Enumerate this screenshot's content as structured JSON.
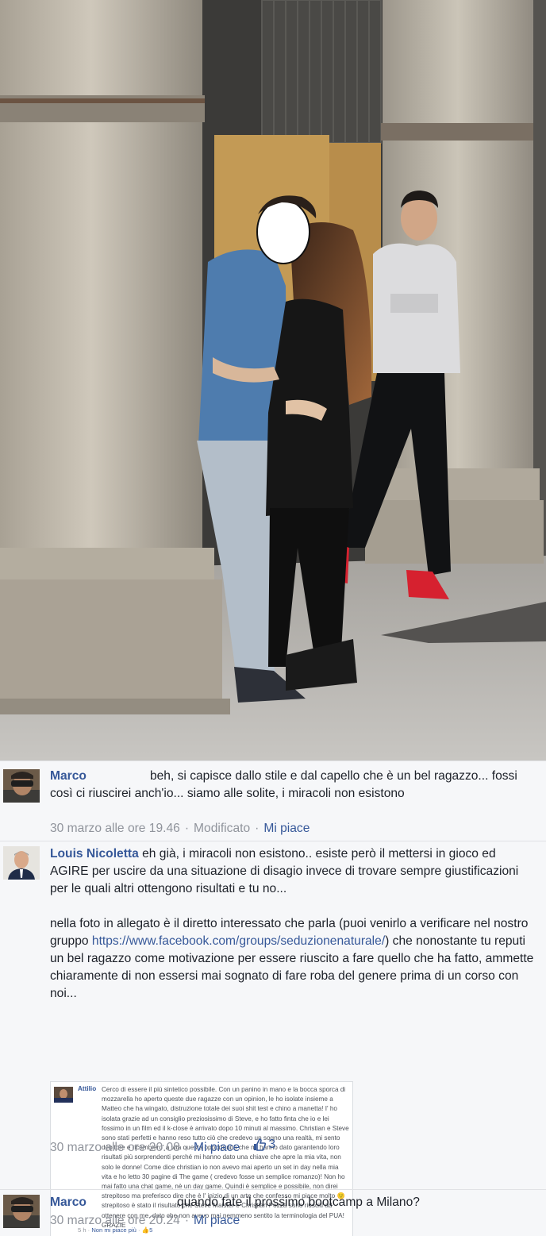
{
  "comments": [
    {
      "author": "Marco",
      "text": "beh, si capisce dallo stile e dal capello che è un bel ragazzo... fossi così ci riuscirei anch'io... siamo alle solite, i miracoli non esistono",
      "timestamp": "30 marzo alle ore 19.46",
      "edited": "Modificato",
      "like_label": "Mi piace"
    },
    {
      "author": "Louis Nicoletta",
      "text_p1": "eh già, i miracoli non esistono.. esiste però il mettersi in gioco ed AGIRE per uscire da una situazione di disagio invece di trovare sempre giustificazioni per le quali altri ottengono risultati e tu no...",
      "text_p2_before": "nella foto in allegato è il diretto interessato che parla (puoi venirlo a verificare nel nostro gruppo ",
      "link": "https://www.facebook.com/groups/seduzionenaturale/",
      "text_p2_after": ") che nonostante tu reputi un bel ragazzo come motivazione per essere riuscito a fare quello che ha fatto, ammette chiaramente di non essersi mai sognato di fare roba del genere prima di un corso con noi...",
      "timestamp": "30 marzo alle ore 20.08",
      "like_label": "Mi piace",
      "like_count": "3",
      "embed": {
        "author": "Attilio",
        "text": "Cerco di essere il più sintetico possibile. Con un panino in mano e la bocca sporca di mozzarella ho aperto queste due ragazze con un opinion, le ho isolate insieme a Matteo che ha wingato, distruzione totale dei suoi shit test e chino a manetta! I' ho isolata grazie ad un consiglio preziosissimo di Steve, e ho fatto finta che io e lei fossimo in un film ed il k-close è arrivato dopo 10 minuti al massimo. Christian e Steve sono stati perfetti e hanno reso tutto ciò che credevo un sogno una realtà, mi sento debitore e ricambiero' a vita questa opportunità che mi hanno dato garantendo loro risultati più sorprendenti perché mi hanno dato una chiave che apre la mia vita, non solo le donne! Come dice christian io non avevo mai aperto un set in day nella mia vita e ho letto 30 pagine di The game ( credevo fosse un semplice romanzo)! Non ho mai fatto una chat game, nè un day game. Quindi è semplice e possibile, non direi strepitoso ma preferisco dire che è l' inizio di un arte che confesso mi piace molto 🙂 strepitoso è stato il risultato che Steve Maister e Christian Pozza sono riusciti ad ottenere con me, dato che non avevo mai nemmeno sentito la terminologia del PUA! GRAZIE",
        "time": "5 h",
        "unlike": "Non mi piace più",
        "likes": "5"
      }
    },
    {
      "author": "Marco",
      "text": "quando fate il prossimo bootcamp a Milano?",
      "timestamp": "30 marzo alle ore 20.24",
      "like_label": "Mi piace"
    }
  ],
  "colors": {
    "link": "#365899",
    "meta": "#90949c",
    "background": "#f6f7f9"
  }
}
